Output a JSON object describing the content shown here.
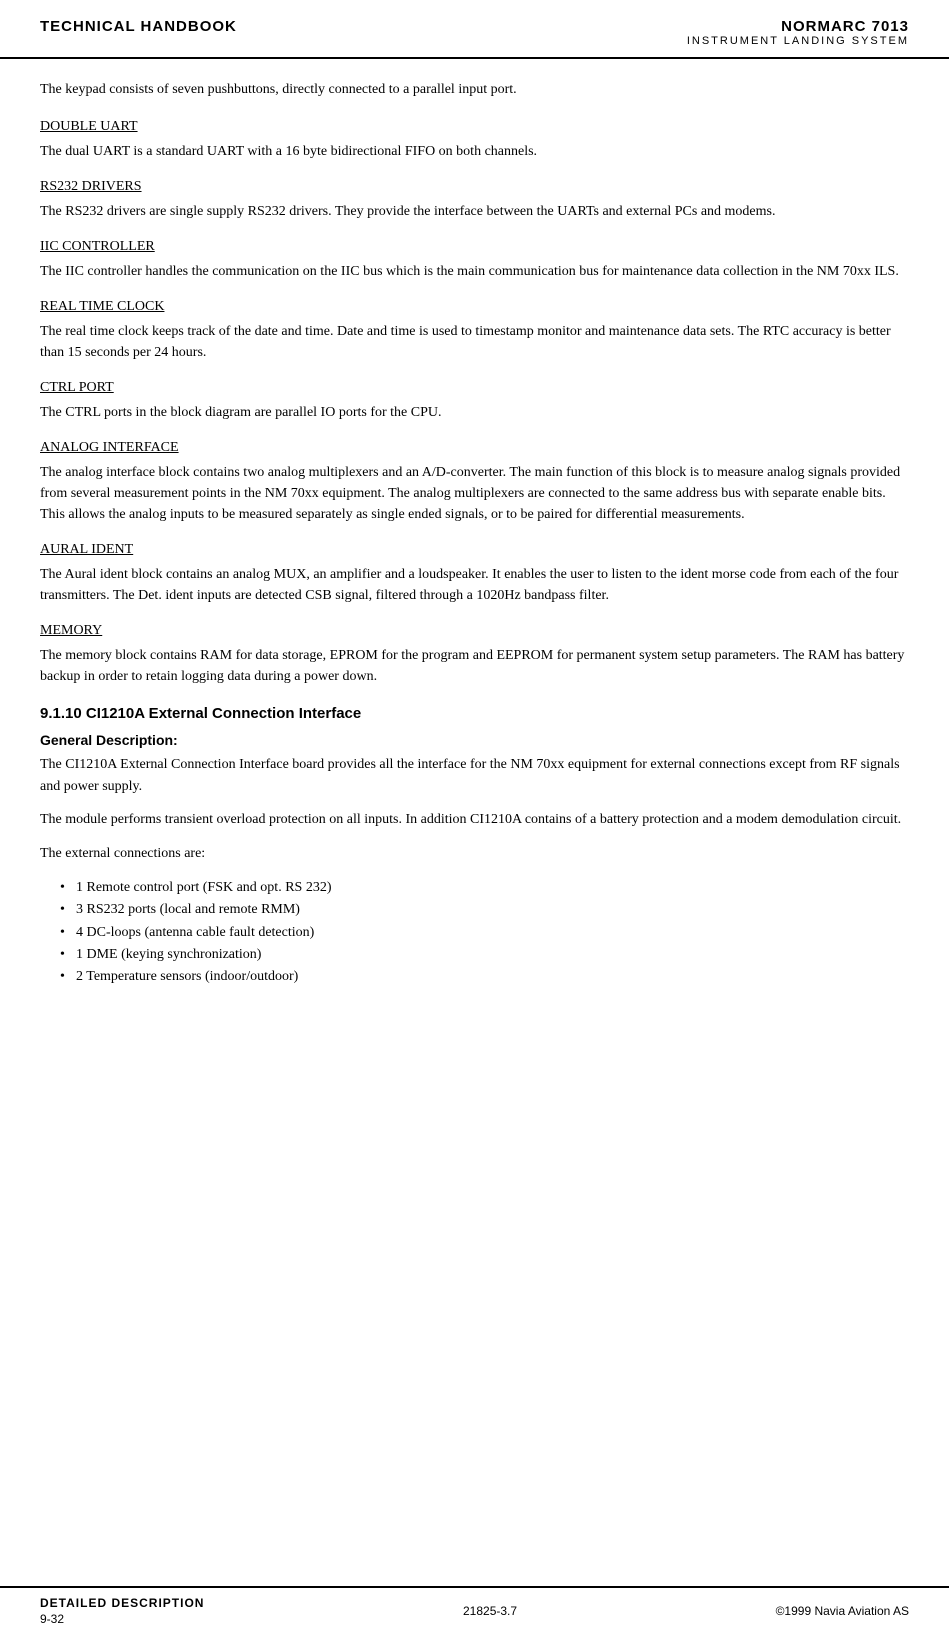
{
  "header": {
    "left": "TECHNICAL HANDBOOK",
    "right_title": "NORMARC 7013",
    "right_subtitle": "INSTRUMENT LANDING SYSTEM"
  },
  "intro": {
    "text": "The keypad consists of seven pushbuttons, directly connected to a parallel input port."
  },
  "sections": [
    {
      "title": "DOUBLE UART",
      "body": "The dual UART is a standard UART with a 16 byte bidirectional FIFO on both channels."
    },
    {
      "title": "RS232 DRIVERS",
      "body": "The RS232 drivers are single supply RS232 drivers. They provide the interface between the UARTs and external PCs and modems."
    },
    {
      "title": "IIC CONTROLLER",
      "body": "The IIC controller handles the communication on the IIC bus which is the main communication bus for maintenance data collection in the NM 70xx ILS."
    },
    {
      "title": "REAL TIME CLOCK",
      "body": "The real time clock keeps track of the date and time. Date and time is used to timestamp monitor and maintenance data sets. The RTC accuracy is better than 15 seconds per 24 hours."
    },
    {
      "title": "CTRL PORT",
      "body": "The CTRL ports in the block diagram are parallel IO ports for the CPU."
    },
    {
      "title": "ANALOG INTERFACE",
      "body": "The analog interface block contains two analog multiplexers and an A/D-converter. The main function of this block is to measure analog signals provided from several measurement points in the NM 70xx equipment. The analog multiplexers are connected to the same address bus with separate enable bits. This allows the analog inputs to be measured separately as single ended signals, or to be paired for differential measurements."
    },
    {
      "title": "AURAL IDENT",
      "body": "The Aural ident block contains an analog MUX, an amplifier and a loudspeaker. It enables the user to listen to the ident morse code from each of the four transmitters. The Det. ident inputs are detected CSB signal, filtered through a 1020Hz bandpass filter."
    },
    {
      "title": "MEMORY",
      "body": "The memory block contains RAM for data storage, EPROM for the program and EEPROM for permanent system setup parameters. The RAM has battery backup in order to retain logging data during a power down."
    }
  ],
  "subsection": {
    "heading": "9.1.10    CI1210A External Connection Interface",
    "general_label": "General Description:",
    "paragraphs": [
      "The CI1210A External Connection Interface board provides all the interface for the NM 70xx equipment for external connections except from RF signals and power supply.",
      "The module performs transient overload protection on all inputs. In addition CI1210A contains of a battery protection and a modem demodulation circuit.",
      "The external connections are:"
    ],
    "bullets": [
      "1 Remote control port (FSK and opt. RS 232)",
      "3 RS232 ports (local and remote RMM)",
      "4 DC-loops (antenna cable fault detection)",
      "1 DME (keying synchronization)",
      "2 Temperature sensors (indoor/outdoor)"
    ]
  },
  "footer": {
    "left": "DETAILED DESCRIPTION",
    "center": "21825-3.7",
    "right": "©1999 Navia Aviation AS",
    "page": "9-32"
  }
}
